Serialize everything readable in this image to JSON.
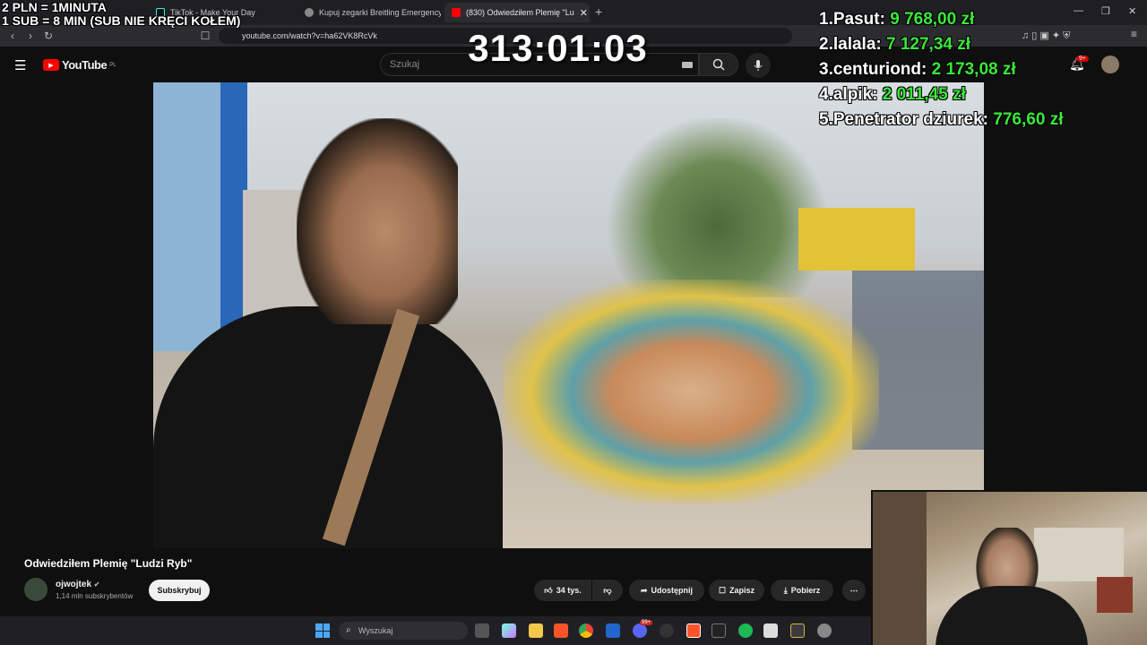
{
  "overlay": {
    "line1": "2 PLN = 1MINUTA",
    "line2": "1 SUB = 8 MIN (SUB NIE KRĘCI KOŁEM)",
    "timer": "313:01:03",
    "leaderboard": [
      {
        "rank": "1.",
        "name": "Pasut:",
        "amount": "9 768,00 zł"
      },
      {
        "rank": "2.",
        "name": "lalala:",
        "amount": "7 127,34 zł"
      },
      {
        "rank": "3.",
        "name": "centuriond:",
        "amount": "2 173,08 zł"
      },
      {
        "rank": "4.",
        "name": "alpik:",
        "amount": "2 011,45 zł"
      },
      {
        "rank": "5.",
        "name": "Penetrator dziurek:",
        "amount": "776,60 zł"
      }
    ]
  },
  "browser": {
    "tabs": [
      {
        "label": "TikTok - Make Your Day"
      },
      {
        "label": "Kupuj zegarki Breitling Emergency II"
      },
      {
        "label": "(830) Odwiedziłem Plemię \"Lu"
      }
    ],
    "url": "youtube.com/watch?v=ha62VK8RcVk"
  },
  "youtube": {
    "logo": "YouTube",
    "region": "PL",
    "search_placeholder": "Szukaj",
    "notif_badge": "9+",
    "video_title": "Odwiedziłem Plemię \"Ludzi Ryb\"",
    "channel_name": "ojwojtek",
    "subscribers": "1,14 mln subskrybentów",
    "subscribe_label": "Subskrybuj",
    "likes": "34 tys.",
    "share_label": "Udostępnij",
    "save_label": "Zapisz",
    "download_label": "Pobierz"
  },
  "taskbar": {
    "search_placeholder": "Wyszukaj",
    "notif_badge": "99+"
  },
  "colors": {
    "leader_amount": "#3be83b",
    "youtube_red": "#ff0000"
  }
}
